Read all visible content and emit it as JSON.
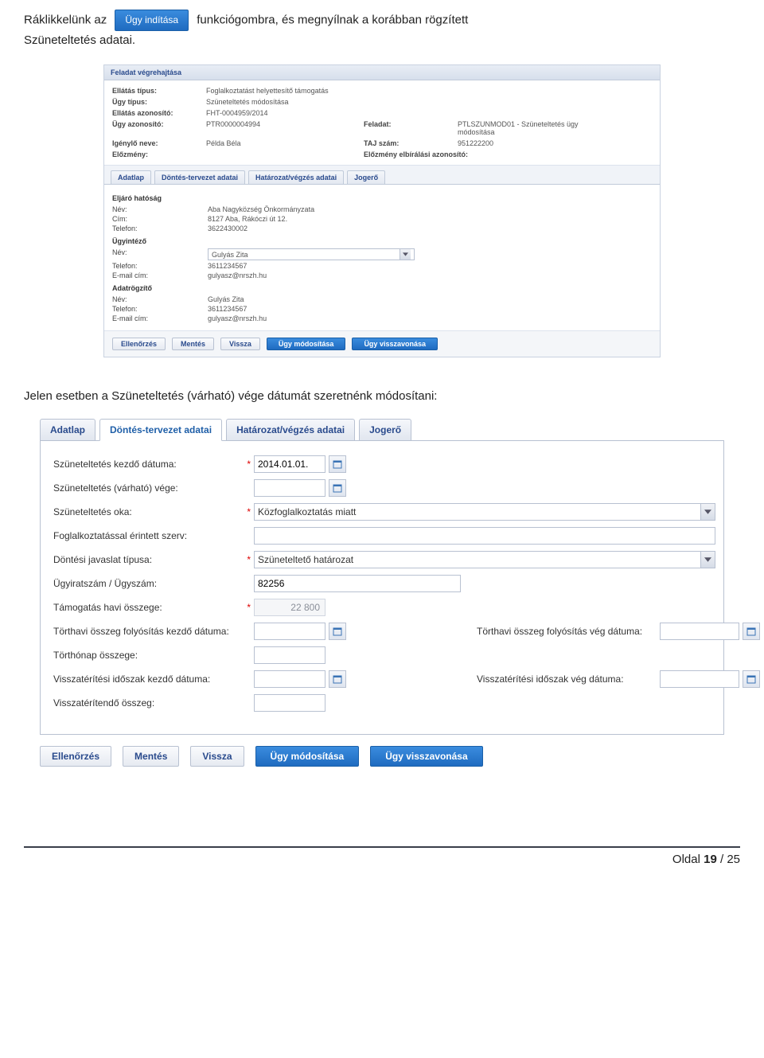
{
  "intro": {
    "p1a": "Ráklikkelünk az",
    "btn": "Ügy indítása",
    "p1b": "funkciógombra, és megnyílnak a korábban rögzített",
    "p2": "Szüneteltetés adatai."
  },
  "panel": {
    "header": "Feladat végrehajtása",
    "labels": {
      "ellatas_tipus": "Ellátás típus:",
      "ugy_tipus": "Ügy típus:",
      "ellatas_azon": "Ellátás azonosító:",
      "ugy_azon": "Ügy azonosító:",
      "feladat": "Feladat:",
      "igenylo": "Igénylő neve:",
      "taj": "TAJ szám:",
      "elozmeny": "Előzmény:",
      "elozmeny_elb": "Előzmény elbírálási azonosító:"
    },
    "values": {
      "ellatas_tipus": "Foglalkoztatást helyettesítő támogatás",
      "ugy_tipus": "Szüneteltetés módosítása",
      "ellatas_azon": "FHT-0004959/2014",
      "ugy_azon": "PTR0000004994",
      "feladat": "PTLSZUNMOD01 - Szüneteltetés ügy módosítása",
      "igenylo": "Példa Béla",
      "taj": "951222200",
      "elozmeny": "",
      "elozmeny_elb": ""
    },
    "tabs": [
      "Adatlap",
      "Döntés-tervezet adatai",
      "Határozat/végzés adatai",
      "Jogerő"
    ],
    "hatosag": {
      "title": "Eljáró hatóság",
      "nev_l": "Név:",
      "nev": "Aba Nagyközség Önkormányzata",
      "cim_l": "Cím:",
      "cim": "8127 Aba, Rákóczi út 12.",
      "tel_l": "Telefon:",
      "tel": "3622430002"
    },
    "ugyintezo": {
      "title": "Ügyintéző",
      "nev_l": "Név:",
      "nev": "Gulyás Zita",
      "tel_l": "Telefon:",
      "tel": "3611234567",
      "mail_l": "E-mail cím:",
      "mail": "gulyasz@nrszh.hu"
    },
    "rogzito": {
      "title": "Adatrögzítő",
      "nev_l": "Név:",
      "nev": "Gulyás Zita",
      "tel_l": "Telefon:",
      "tel": "3611234567",
      "mail_l": "E-mail cím:",
      "mail": "gulyasz@nrszh.hu"
    },
    "buttons": {
      "ellenorzes": "Ellenőrzés",
      "mentes": "Mentés",
      "vissza": "Vissza",
      "modositas": "Ügy módosítása",
      "visszavonas": "Ügy visszavonása"
    }
  },
  "midtext": "Jelen esetben a Szüneteltetés (várható) vége dátumát szeretnénk módosítani:",
  "form": {
    "tabs": [
      "Adatlap",
      "Döntés-tervezet adatai",
      "Határozat/végzés adatai",
      "Jogerő"
    ],
    "labels": {
      "kezdo": "Szüneteltetés kezdő dátuma:",
      "vege": "Szüneteltetés (várható) vége:",
      "oka": "Szüneteltetés oka:",
      "szerv": "Foglalkoztatással érintett szerv:",
      "javaslat": "Döntési javaslat típusa:",
      "ugyirat": "Ügyiratszám / Ügyszám:",
      "havi": "Támogatás havi összege:",
      "tort_kezdo": "Törthavi összeg folyósítás kezdő dátuma:",
      "tort_veg": "Törthavi összeg folyósítás vég dátuma:",
      "tort_osszeg": "Törthónap összege:",
      "vissza_kezdo": "Visszatérítési időszak kezdő dátuma:",
      "vissza_veg": "Visszatérítési időszak vég dátuma:",
      "vissza_osszeg": "Visszatérítendő összeg:"
    },
    "values": {
      "kezdo": "2014.01.01.",
      "vege": "",
      "oka": "Közfoglalkoztatás miatt",
      "szerv": "",
      "javaslat": "Szüneteltető határozat",
      "ugyirat": "82256",
      "havi": "22 800",
      "tort_kezdo": "",
      "tort_veg": "",
      "tort_osszeg": "",
      "vissza_kezdo": "",
      "vissza_veg": "",
      "vissza_osszeg": ""
    },
    "buttons": {
      "ellenorzes": "Ellenőrzés",
      "mentes": "Mentés",
      "vissza": "Vissza",
      "modositas": "Ügy módosítása",
      "visszavonas": "Ügy visszavonása"
    }
  },
  "footer": {
    "prefix": "Oldal ",
    "page": "19",
    "sep": " / ",
    "total": "25"
  }
}
